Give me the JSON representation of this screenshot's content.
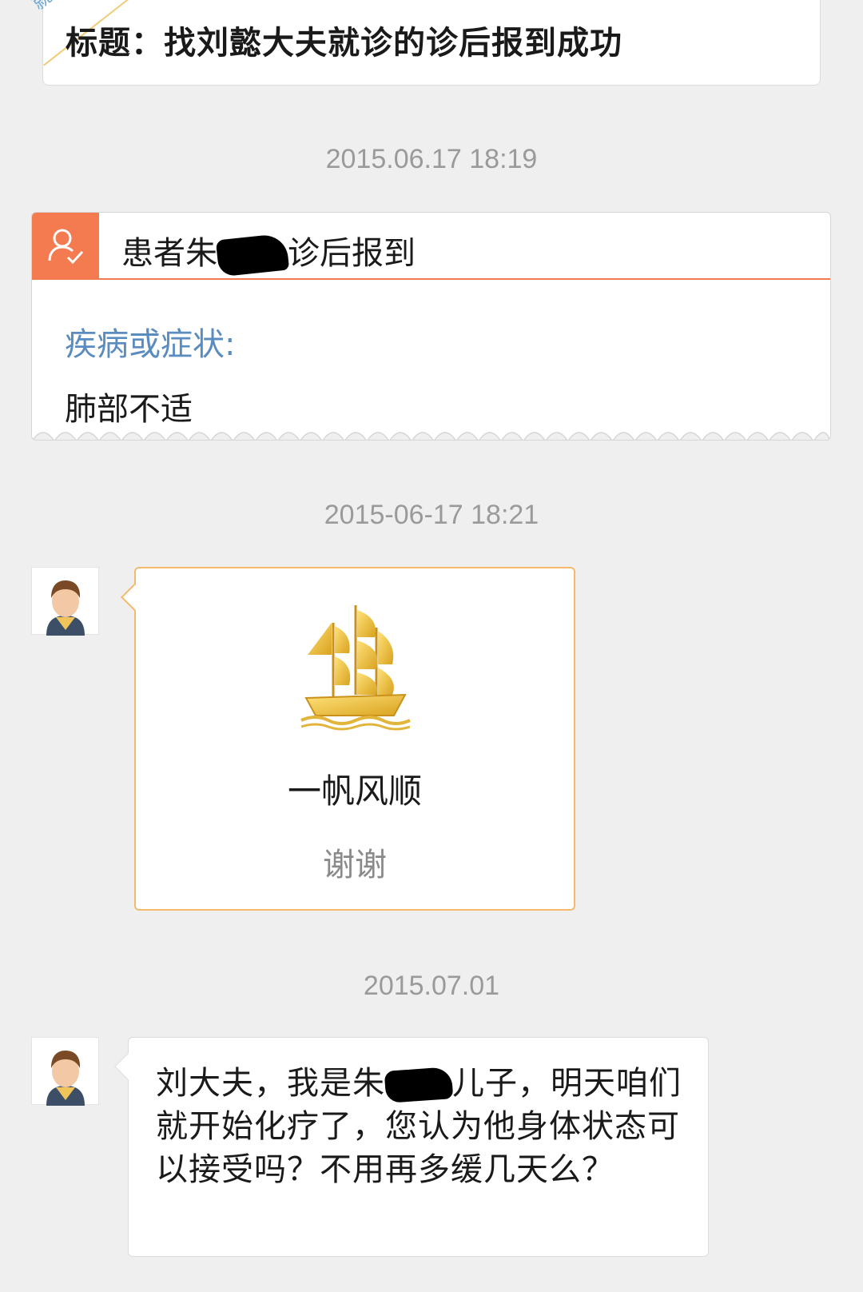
{
  "title_card": {
    "corner_tag": "就诊后",
    "title": "标题：找刘懿大夫就诊的诊后报到成功"
  },
  "timestamps": {
    "first": "2015.06.17 18:19",
    "second": "2015-06-17 18:21",
    "third": "2015.07.01"
  },
  "report_card": {
    "icon": "user-check-icon",
    "header_prefix": "患者朱",
    "header_suffix": "诊后报到",
    "symptom_label": "疾病或症状:",
    "symptom_value": "肺部不适"
  },
  "gift_message": {
    "icon": "golden-ship-icon",
    "gift_name": "一帆风顺",
    "note": "谢谢"
  },
  "text_message": {
    "prefix": "刘大夫，我是朱",
    "suffix": "儿子，明天咱们就开始化疗了，您认为他身体状态可以接受吗？不用再多缓几天么？"
  },
  "colors": {
    "accent_orange": "#f47b50",
    "label_blue": "#5a8cc0",
    "bubble_border": "#f4b96b",
    "background": "#efefef"
  }
}
